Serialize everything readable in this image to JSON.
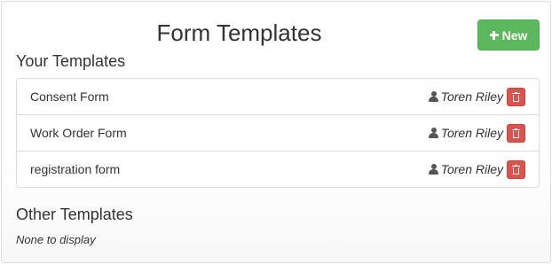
{
  "page": {
    "title": "Form Templates"
  },
  "header": {
    "new_button_label": "New"
  },
  "your_templates": {
    "heading": "Your Templates",
    "items": [
      {
        "name": "Consent Form",
        "owner": "Toren Riley"
      },
      {
        "name": "Work Order Form",
        "owner": "Toren Riley"
      },
      {
        "name": "registration form",
        "owner": "Toren Riley"
      }
    ]
  },
  "other_templates": {
    "heading": "Other Templates",
    "empty_text": "None to display"
  },
  "colors": {
    "new_button": "#5cb85c",
    "delete_button": "#d9534f"
  },
  "icons": {
    "new_button": "plus-icon",
    "owner": "user-icon",
    "delete": "trash-icon"
  }
}
